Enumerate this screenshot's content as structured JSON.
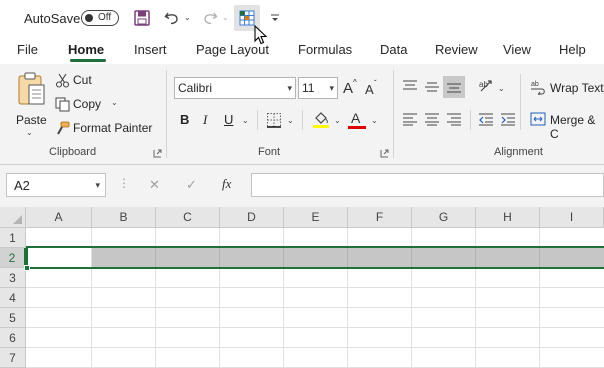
{
  "qat": {
    "autosave_label": "AutoSave",
    "toggle_label": "Off"
  },
  "tabs": [
    "File",
    "Home",
    "Insert",
    "Page Layout",
    "Formulas",
    "Data",
    "Review",
    "View",
    "Help"
  ],
  "active_tab": "Home",
  "clipboard": {
    "paste": "Paste",
    "cut": "Cut",
    "copy": "Copy",
    "format_painter": "Format Painter",
    "group_label": "Clipboard"
  },
  "font": {
    "name": "Calibri",
    "size": "11",
    "grow": "A",
    "shrink": "A",
    "bold": "B",
    "italic": "I",
    "underline": "U",
    "font_color_letter": "A",
    "group_label": "Font"
  },
  "alignment": {
    "wrap_text": "Wrap Text",
    "merge": "Merge & C",
    "group_label": "Alignment"
  },
  "formula_bar": {
    "name_box": "A2",
    "cancel": "✕",
    "enter": "✓",
    "fx": "fx",
    "formula": ""
  },
  "sheet": {
    "columns": [
      "A",
      "B",
      "C",
      "D",
      "E",
      "F",
      "G",
      "H",
      "I"
    ],
    "rows": [
      "1",
      "2",
      "3",
      "4",
      "5",
      "6",
      "7"
    ],
    "active_cell": "A2",
    "selected_row": "2"
  },
  "colors": {
    "accent": "#1f6f3b",
    "ribbon_bg": "#f3f3f3",
    "header_bg": "#e6e6e6",
    "selection_bg": "#c6c6c6",
    "highlight_yellow": "#ffff00",
    "font_red": "#e00000"
  }
}
